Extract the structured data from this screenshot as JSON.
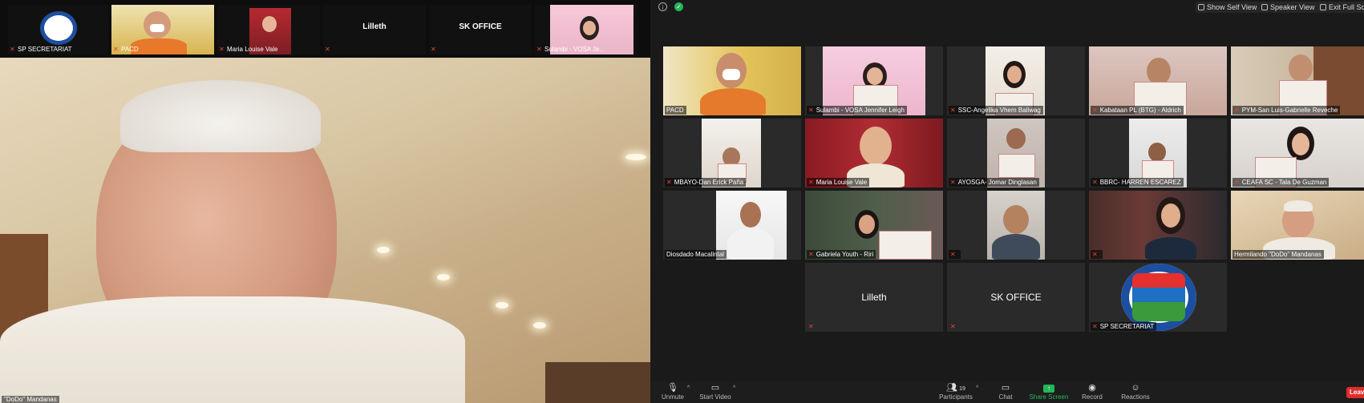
{
  "left_strip": {
    "tiles": [
      {
        "name": "SP SECRETARIAT"
      },
      {
        "name": "PACD"
      },
      {
        "name": "Maria Louise Vale"
      },
      {
        "name": "",
        "center": "Lilleth"
      },
      {
        "name": "",
        "center": "SK OFFICE"
      },
      {
        "name": "Sulambi - VOSA Je..."
      }
    ]
  },
  "speaker": {
    "name": "\"DoDo\" Mandanas"
  },
  "topbar": {
    "self_view_label": "Show Self View",
    "speaker_view_label": "Speaker View",
    "exit_full_label": "Exit Full Sc"
  },
  "gallery": [
    {
      "name": "PACD",
      "muted": false
    },
    {
      "name": "Sulambi - VOSA Jennifer Leigh",
      "muted": true
    },
    {
      "name": "SSC-Angelika Vhem Baliwag",
      "muted": true
    },
    {
      "name": "Kabataan PL (BTG) - Aldrich",
      "muted": true
    },
    {
      "name": "PYM-San Luis-Gabrielle Reveche",
      "muted": true
    },
    {
      "name": "MBAYO-Dan Erick Paña",
      "muted": true
    },
    {
      "name": "Maria Louise Vale",
      "muted": true
    },
    {
      "name": "AYOSGA- Jomar Dinglasan",
      "muted": true
    },
    {
      "name": "BBRC- HARREN ESCAREZ",
      "muted": true
    },
    {
      "name": "CEAFA SC - Tala De Guzman",
      "muted": true
    },
    {
      "name": "Diosdado Macalintal",
      "muted": false
    },
    {
      "name": "Gabriela Youth - Riri",
      "muted": true
    },
    {
      "name": "",
      "muted": true
    },
    {
      "name": "",
      "muted": true
    },
    {
      "name": "Hermilando \"DoDo\" Mandanas",
      "muted": false
    },
    {
      "name": "",
      "muted": true,
      "center": "Lilleth"
    },
    {
      "name": "",
      "muted": true,
      "center": "SK OFFICE"
    },
    {
      "name": "SP SECRETARIAT",
      "muted": true
    }
  ],
  "controls": {
    "unmute": "Unmute",
    "start_video": "Start Video",
    "participants": "Participants",
    "participants_count": "19",
    "chat": "Chat",
    "share_screen": "Share Screen",
    "record": "Record",
    "reactions": "Reactions",
    "leave": "Leav"
  },
  "colors": {
    "accent_green": "#23b65a",
    "mute_red": "#e0463a",
    "active_speaker": "#c9d72a",
    "leave_red": "#e02d2d"
  }
}
